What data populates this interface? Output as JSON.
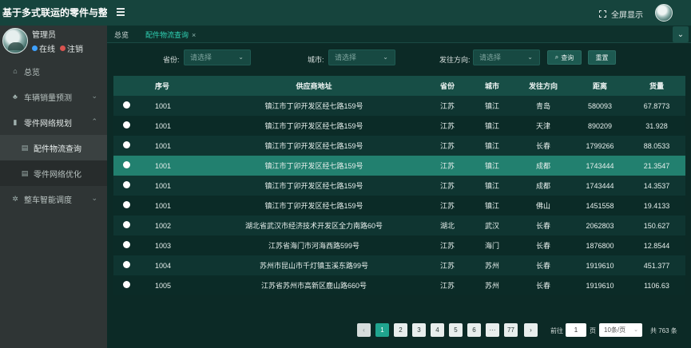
{
  "app": {
    "title": "基于多式联运的零件与整车智能调",
    "fullscreen_label": "全屏显示"
  },
  "user": {
    "name": "管理员",
    "online_label": "在线",
    "logout_label": "注销"
  },
  "sidebar": {
    "items": [
      {
        "label": "总览",
        "icon": "home-icon"
      },
      {
        "label": "车辆销量预测",
        "icon": "tree-icon"
      },
      {
        "label": "零件网络规划",
        "icon": "book-icon"
      },
      {
        "label": "配件物流查询",
        "icon": "list-icon"
      },
      {
        "label": "零件网络优化",
        "icon": "list-icon"
      },
      {
        "label": "整车智能调度",
        "icon": "gear-icon"
      }
    ]
  },
  "tabs": {
    "home": "总览",
    "active": "配件物流查询",
    "close": "×"
  },
  "filters": {
    "province_label": "省份:",
    "province_placeholder": "请选择",
    "city_label": "城市:",
    "city_placeholder": "请选择",
    "direction_label": "发往方向:",
    "direction_placeholder": "请选择",
    "search_label": "查询",
    "reset_label": "重置"
  },
  "table": {
    "headers": [
      "序号",
      "供应商地址",
      "省份",
      "城市",
      "发往方向",
      "距离",
      "货量"
    ],
    "rows": [
      [
        "1001",
        "镇江市丁卯开发区经七路159号",
        "江苏",
        "镇江",
        "青岛",
        "580093",
        "67.8773"
      ],
      [
        "1001",
        "镇江市丁卯开发区经七路159号",
        "江苏",
        "镇江",
        "天津",
        "890209",
        "31.928"
      ],
      [
        "1001",
        "镇江市丁卯开发区经七路159号",
        "江苏",
        "镇江",
        "长春",
        "1799266",
        "88.0533"
      ],
      [
        "1001",
        "镇江市丁卯开发区经七路159号",
        "江苏",
        "镇江",
        "成都",
        "1743444",
        "21.3547"
      ],
      [
        "1001",
        "镇江市丁卯开发区经七路159号",
        "江苏",
        "镇江",
        "成都",
        "1743444",
        "14.3537"
      ],
      [
        "1001",
        "镇江市丁卯开发区经七路159号",
        "江苏",
        "镇江",
        "佛山",
        "1451558",
        "19.4133"
      ],
      [
        "1002",
        "湖北省武汉市经济技术开发区全力南路60号",
        "湖北",
        "武汉",
        "长春",
        "2062803",
        "150.627"
      ],
      [
        "1003",
        "江苏省海门市河海西路599号",
        "江苏",
        "海门",
        "长春",
        "1876800",
        "12.8544"
      ],
      [
        "1004",
        "苏州市昆山市千灯镇玉溪东路99号",
        "江苏",
        "苏州",
        "长春",
        "1919610",
        "451.377"
      ],
      [
        "1005",
        "江苏省苏州市高新区鹿山路660号",
        "江苏",
        "苏州",
        "长春",
        "1919610",
        "1106.63"
      ]
    ],
    "highlight_row": 3
  },
  "pagination": {
    "prev": "‹",
    "next": "›",
    "pages": [
      "1",
      "2",
      "3",
      "4",
      "5",
      "6",
      "···",
      "77"
    ],
    "current": "1",
    "goto_label": "前往",
    "goto_value": "1",
    "page_suffix": "页",
    "page_size": "10条/页",
    "total": "共 763 条"
  },
  "colors": {
    "sidebar_bg": "#2f3535",
    "header_bg": "#16443d",
    "accent": "#20a58f",
    "row_highlight": "#22806f"
  }
}
